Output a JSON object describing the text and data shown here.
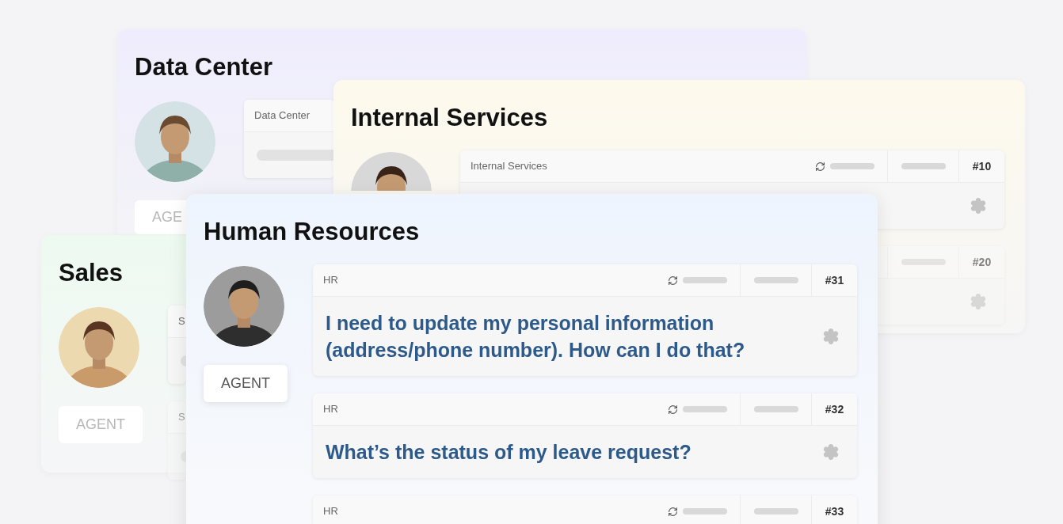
{
  "cards": [
    {
      "title": "Data Center",
      "in_focus": false,
      "avatar": {
        "kind": "picture"
      },
      "agent_label": "AGE",
      "tickets": [
        {
          "category": "Data Center"
        }
      ]
    },
    {
      "title": "Internal Services",
      "in_focus": false,
      "avatar": {
        "kind": "picture"
      },
      "tickets": [
        {
          "category": "Internal Services",
          "number": "#10"
        },
        {
          "number": "#20"
        }
      ]
    },
    {
      "title": "Sales",
      "in_focus": false,
      "avatar": {
        "kind": "picture"
      },
      "agent_label": "AGENT",
      "tickets": [
        {
          "category": "S"
        },
        {
          "category": "S"
        }
      ]
    },
    {
      "title": "Human Resources",
      "in_focus": true,
      "avatar": {
        "kind": "picture"
      },
      "agent_label": "AGENT",
      "tickets": [
        {
          "category": "HR",
          "number": "#31",
          "question": "I need to update my personal information (address/phone number). How can I do that?"
        },
        {
          "category": "HR",
          "number": "#32",
          "question": "What’s the status of my leave request?"
        },
        {
          "category": "HR",
          "number": "#33"
        }
      ]
    }
  ]
}
